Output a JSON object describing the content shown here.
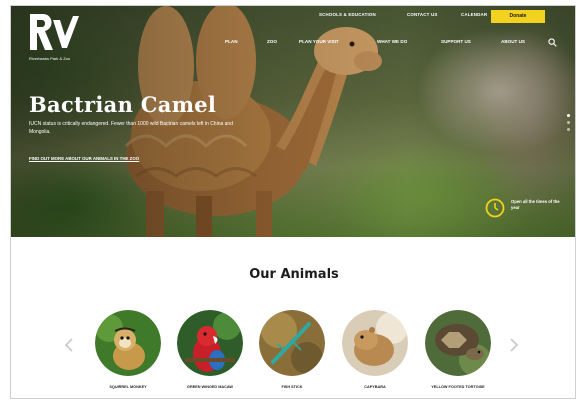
{
  "site": {
    "logo_text": "Riverbanks Park & Zoo",
    "top_links": [
      "Schools & Education",
      "Contact Us",
      "Calendar"
    ],
    "donate_label": "Donate",
    "nav": [
      "Plan",
      "Zoo",
      "Plan Your Visit",
      "What We Do",
      "Support Us",
      "About Us"
    ]
  },
  "hero": {
    "title": "Bactrian Camel",
    "description": "IUCN status is critically endangered. Fewer than 1000 wild Bactrian camels left in China and Mongolia.",
    "link_label": "Find out more about our animals in the Zoo",
    "open_text": "Open all the times of the year",
    "slides": 3,
    "active_slide": 1
  },
  "animals_section": {
    "title": "Our Animals",
    "items": [
      {
        "name": "Squirrel Monkey",
        "icon": "squirrel-monkey"
      },
      {
        "name": "Green Winged Macaw",
        "icon": "macaw"
      },
      {
        "name": "Fish Stick",
        "icon": "stick-insect"
      },
      {
        "name": "Capybara",
        "icon": "capybara"
      },
      {
        "name": "Yellow Footed Tortoise",
        "icon": "tortoise"
      }
    ]
  },
  "colors": {
    "accent_yellow": "#f2d21f",
    "text_dark": "#1c1c1c"
  }
}
